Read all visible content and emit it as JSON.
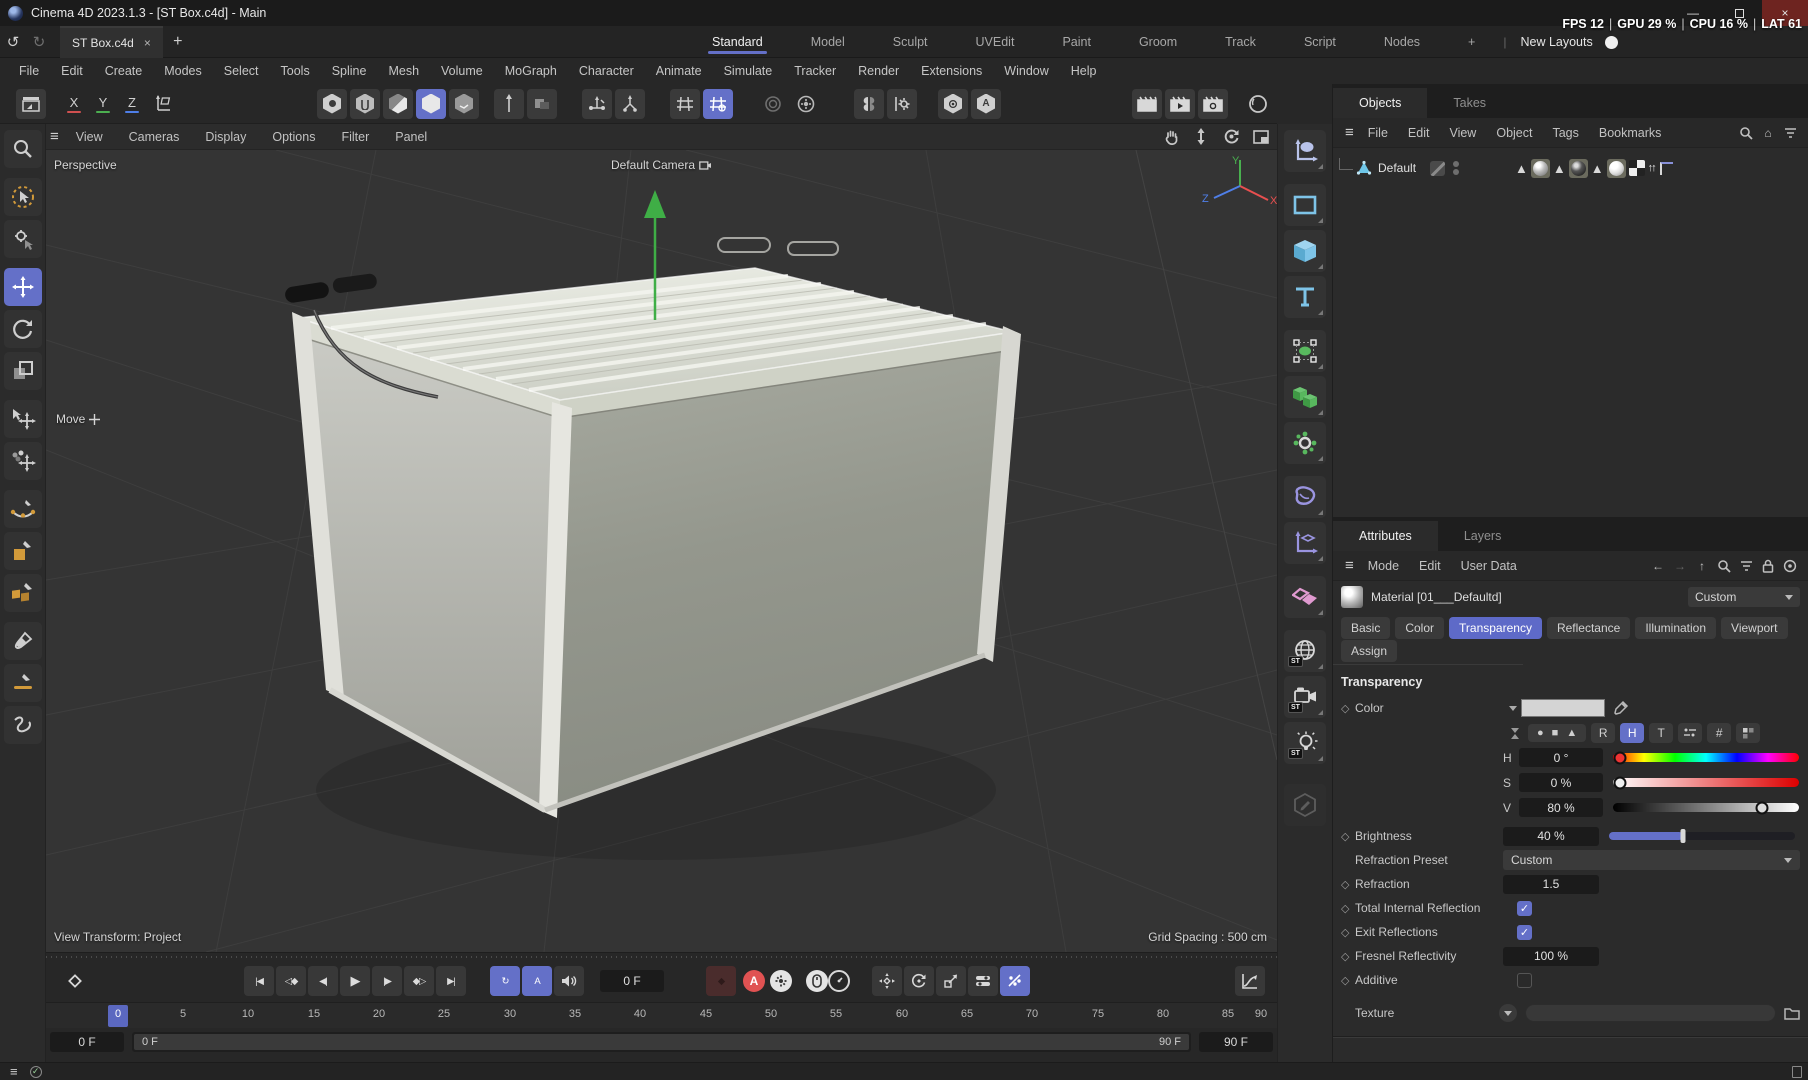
{
  "titlebar": {
    "title": "Cinema 4D 2023.1.3 - [ST Box.c4d] - Main"
  },
  "overlay_stats": {
    "fps_label": "FPS",
    "fps_value": "12",
    "gpu_label": "GPU",
    "gpu_value": "29 %",
    "cpu_label": "CPU",
    "cpu_value": "16 %",
    "lat_label": "LAT",
    "lat_value": "61",
    "sep": "|"
  },
  "tabbar": {
    "document_tab": "ST Box.c4d",
    "layout_tabs": [
      "Standard",
      "Model",
      "Sculpt",
      "UVEdit",
      "Paint",
      "Groom",
      "Track",
      "Script",
      "Nodes"
    ],
    "new_layouts_label": "New Layouts"
  },
  "menubar": {
    "items": [
      "File",
      "Edit",
      "Create",
      "Modes",
      "Select",
      "Tools",
      "Spline",
      "Mesh",
      "Volume",
      "MoGraph",
      "Character",
      "Animate",
      "Simulate",
      "Tracker",
      "Render",
      "Extensions",
      "Window",
      "Help"
    ]
  },
  "toolbar": {
    "axis_x": "X",
    "axis_y": "Y",
    "axis_z": "Z",
    "annotation_letter": "A"
  },
  "viewport": {
    "menu": [
      "View",
      "Cameras",
      "Display",
      "Options",
      "Filter",
      "Panel"
    ],
    "view_label": "Perspective",
    "camera_label": "Default Camera",
    "tool_hint": "Move",
    "transform_info": "View Transform: Project",
    "grid_info": "Grid Spacing : 500 cm",
    "axis_x": "X",
    "axis_y": "Y",
    "axis_z": "Z"
  },
  "right_palette": {
    "st_badge": "ST"
  },
  "objects_panel": {
    "tab_objects": "Objects",
    "tab_takes": "Takes",
    "menu": [
      "File",
      "Edit",
      "View",
      "Object",
      "Tags",
      "Bookmarks"
    ],
    "object_name": "Default"
  },
  "attributes_panel": {
    "tab_attributes": "Attributes",
    "tab_layers": "Layers",
    "menu": [
      "Mode",
      "Edit",
      "User Data"
    ],
    "material_name": "Material [01___Defaultd]",
    "material_preset": "Custom",
    "chips": [
      "Basic",
      "Color",
      "Transparency",
      "Reflectance",
      "Illumination",
      "Viewport"
    ],
    "assign_label": "Assign",
    "transparency": {
      "heading": "Transparency",
      "color_label": "Color",
      "channels": [
        "R",
        "H",
        "T"
      ],
      "h_label": "H",
      "h_value": "0 °",
      "s_label": "S",
      "s_value": "0 %",
      "v_label": "V",
      "v_value": "80 %",
      "brightness_label": "Brightness",
      "brightness_value": "40 %",
      "refraction_preset_label": "Refraction Preset",
      "refraction_preset_value": "Custom",
      "refraction_label": "Refraction",
      "refraction_value": "1.5",
      "tir_label": "Total Internal Reflection",
      "exit_reflections_label": "Exit Reflections",
      "fresnel_label": "Fresnel Reflectivity",
      "fresnel_value": "100 %",
      "additive_label": "Additive",
      "texture_label": "Texture"
    }
  },
  "timeline": {
    "autokey_letter": "A",
    "current_frame": "0 F",
    "ticks": [
      "0",
      "5",
      "10",
      "15",
      "20",
      "25",
      "30",
      "35",
      "40",
      "45",
      "50",
      "55",
      "60",
      "65",
      "70",
      "75",
      "80",
      "85",
      "90"
    ],
    "range_start": "0 F",
    "range_end": "90 F",
    "range_bar_start": "0 F",
    "range_bar_end": "90 F",
    "transport": {
      "go_start": "|◀",
      "prev_key": "◁◆",
      "prev_frame": "◀|",
      "play": "▶",
      "next_frame": "|▶",
      "next_key": "◆▷",
      "go_end": "▶|"
    }
  },
  "glyphs": {
    "hamburger": "≡",
    "plus": "+",
    "close": "×",
    "minimize": "—",
    "undo": "↺",
    "redo": "↻",
    "check": "✓",
    "triangle": "▲",
    "circle": "●",
    "square": "■",
    "diamond": "◆",
    "diamond_open": "◇",
    "arrow_up": "↑",
    "arrow_left": "←",
    "arrow_right": "→",
    "hash": "#",
    "home": "⌂",
    "pipe": "|",
    "rotate": "↻",
    "double_up": "↑↑"
  },
  "colors": {
    "accent": "#6470c8",
    "autokey_red": "#e05252",
    "axis_x": "#e84f4f",
    "axis_y": "#49b04f",
    "axis_z": "#4f7fe8"
  }
}
